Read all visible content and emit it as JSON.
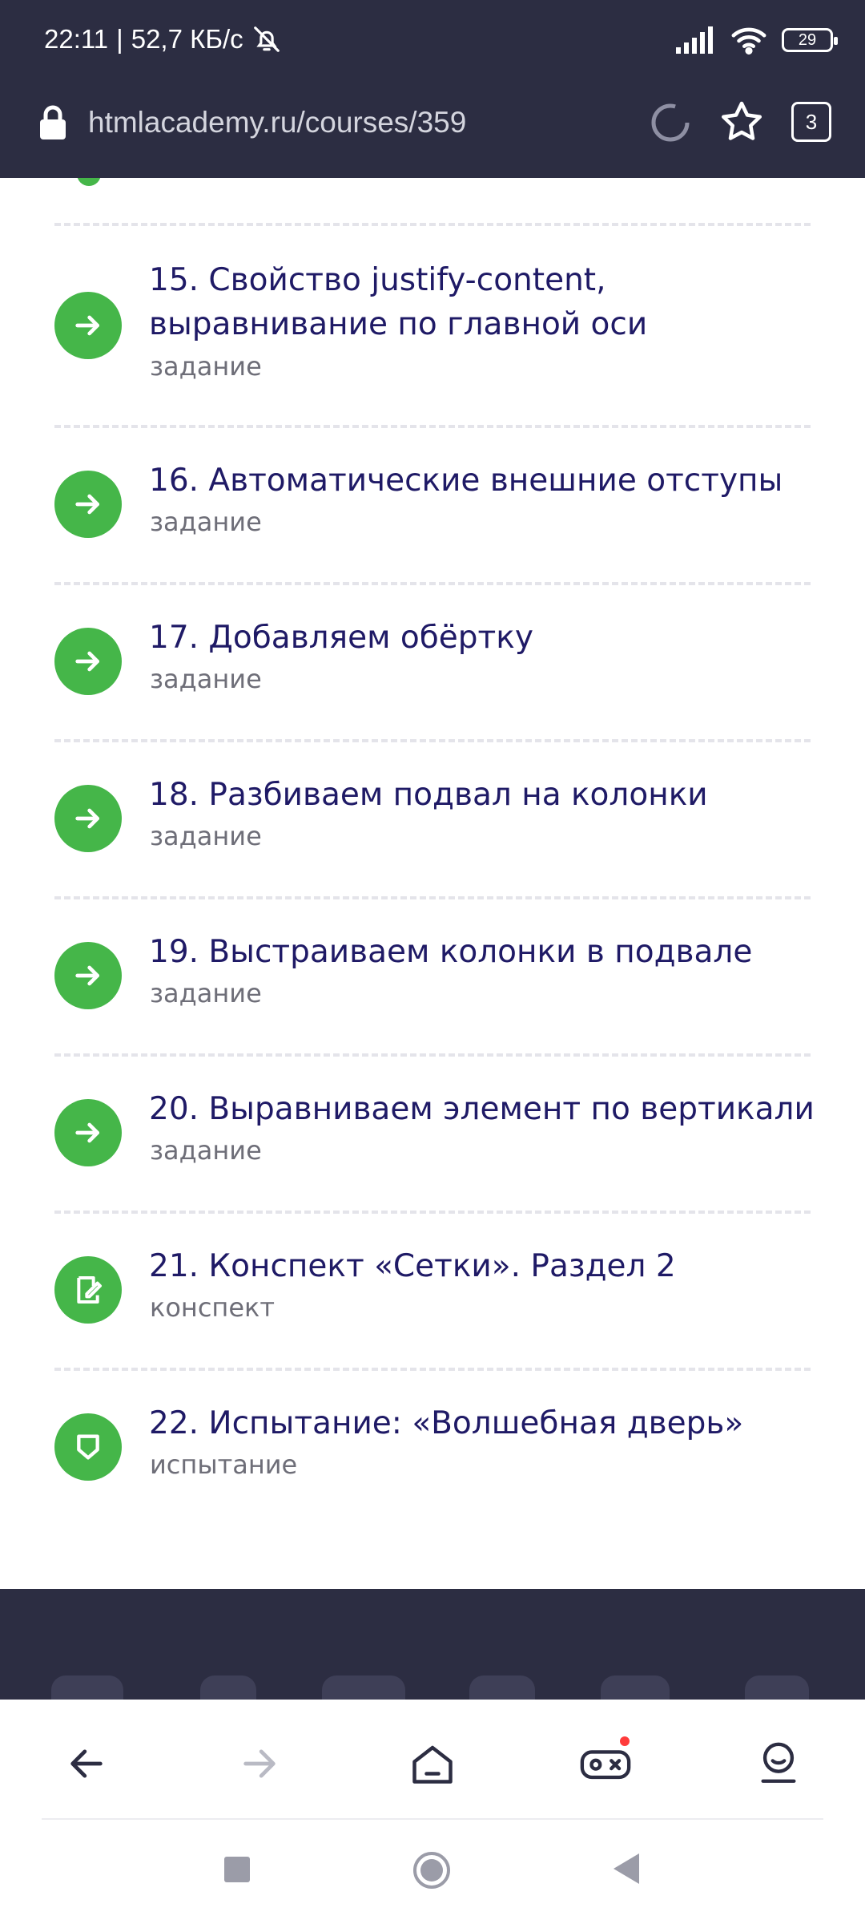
{
  "status": {
    "time": "22:11",
    "separator": "|",
    "speed": "52,7 КБ/с",
    "battery": "29"
  },
  "browser": {
    "url": "htmlacademy.ru/courses/359",
    "tabs_count": "3"
  },
  "lessons": [
    {
      "number_title": "15. Свойство justify-content, выравнивание по главной оси",
      "type": "задание",
      "icon": "arrow-right-icon"
    },
    {
      "number_title": "16. Автоматические внешние отступы",
      "type": "задание",
      "icon": "arrow-right-icon"
    },
    {
      "number_title": "17. Добавляем обёртку",
      "type": "задание",
      "icon": "arrow-right-icon"
    },
    {
      "number_title": "18. Разбиваем подвал на колонки",
      "type": "задание",
      "icon": "arrow-right-icon"
    },
    {
      "number_title": "19. Выстраиваем колонки в подвале",
      "type": "задание",
      "icon": "arrow-right-icon"
    },
    {
      "number_title": "20. Выравниваем элемент по вертикали",
      "type": "задание",
      "icon": "arrow-right-icon"
    },
    {
      "number_title": "21. Конспект «Сетки». Раздел 2",
      "type": "конспект",
      "icon": "note-edit-icon"
    },
    {
      "number_title": "22. Испытание: «Волшебная дверь»",
      "type": "испытание",
      "icon": "shield-icon"
    }
  ],
  "colors": {
    "header_bg": "#2c2d42",
    "accent_green": "#45b649",
    "title_color": "#1f1a66",
    "subtitle_color": "#6e6e78",
    "notification_dot": "#ff3b3b"
  }
}
